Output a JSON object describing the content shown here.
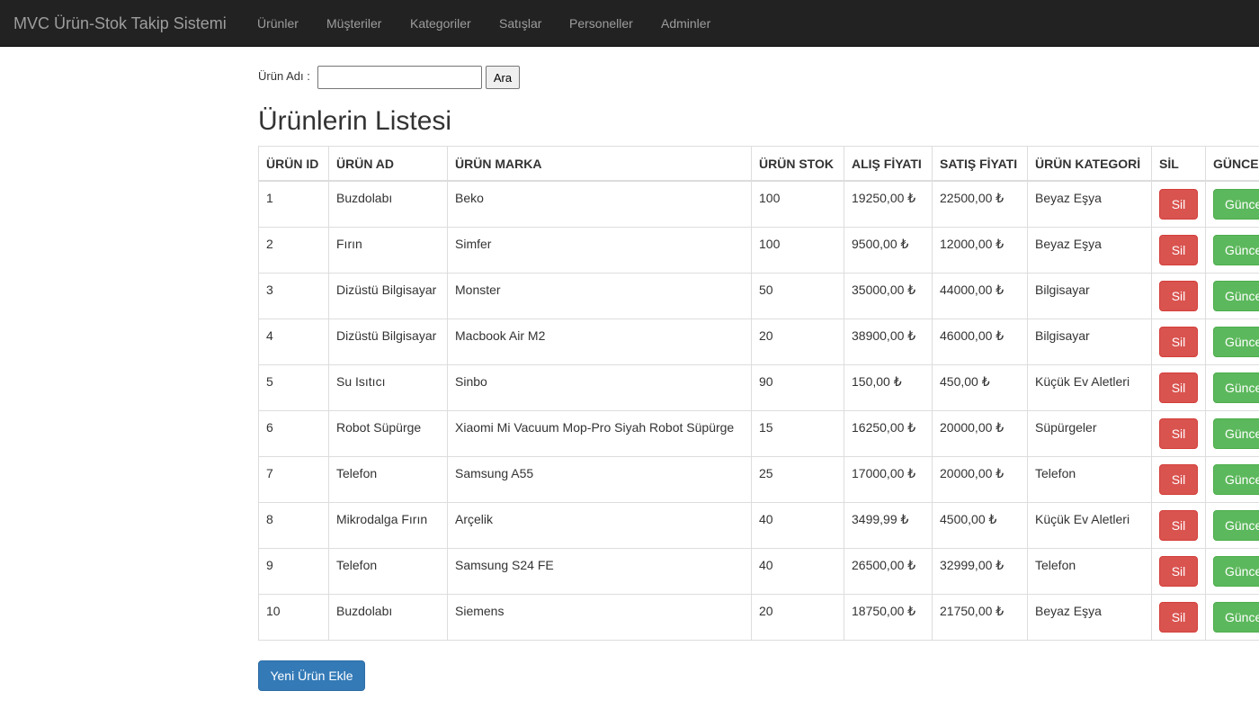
{
  "navbar": {
    "brand": "MVC Ürün-Stok Takip Sistemi",
    "items": [
      {
        "label": "Ürünler"
      },
      {
        "label": "Müşteriler"
      },
      {
        "label": "Kategoriler"
      },
      {
        "label": "Satışlar"
      },
      {
        "label": "Personeller"
      },
      {
        "label": "Adminler"
      }
    ]
  },
  "search": {
    "label": "Ürün Adı :",
    "value": "",
    "button_label": "Ara"
  },
  "page_title": "Ürünlerin Listesi",
  "table": {
    "headers": [
      "ÜRÜN ID",
      "ÜRÜN AD",
      "ÜRÜN MARKA",
      "ÜRÜN STOK",
      "ALIŞ FİYATI",
      "SATIŞ FİYATI",
      "ÜRÜN KATEGORİ",
      "SİL",
      "GÜNCELLE"
    ],
    "delete_label": "Sil",
    "update_label": "Güncelle",
    "rows": [
      {
        "id": "1",
        "name": "Buzdolabı",
        "brand": "Beko",
        "stock": "100",
        "buy": "19250,00 ₺",
        "sell": "22500,00 ₺",
        "category": "Beyaz Eşya"
      },
      {
        "id": "2",
        "name": "Fırın",
        "brand": "Simfer",
        "stock": "100",
        "buy": "9500,00 ₺",
        "sell": "12000,00 ₺",
        "category": "Beyaz Eşya"
      },
      {
        "id": "3",
        "name": "Dizüstü Bilgisayar",
        "brand": "Monster",
        "stock": "50",
        "buy": "35000,00 ₺",
        "sell": "44000,00 ₺",
        "category": "Bilgisayar"
      },
      {
        "id": "4",
        "name": "Dizüstü Bilgisayar",
        "brand": "Macbook Air M2",
        "stock": "20",
        "buy": "38900,00 ₺",
        "sell": "46000,00 ₺",
        "category": "Bilgisayar"
      },
      {
        "id": "5",
        "name": "Su Isıtıcı",
        "brand": "Sinbo",
        "stock": "90",
        "buy": "150,00 ₺",
        "sell": "450,00 ₺",
        "category": "Küçük Ev Aletleri"
      },
      {
        "id": "6",
        "name": "Robot Süpürge",
        "brand": "Xiaomi Mi Vacuum Mop-Pro Siyah Robot Süpürge",
        "stock": "15",
        "buy": "16250,00 ₺",
        "sell": "20000,00 ₺",
        "category": "Süpürgeler"
      },
      {
        "id": "7",
        "name": "Telefon",
        "brand": "Samsung A55",
        "stock": "25",
        "buy": "17000,00 ₺",
        "sell": "20000,00 ₺",
        "category": "Telefon"
      },
      {
        "id": "8",
        "name": "Mikrodalga Fırın",
        "brand": "Arçelik",
        "stock": "40",
        "buy": "3499,99 ₺",
        "sell": "4500,00 ₺",
        "category": "Küçük Ev Aletleri"
      },
      {
        "id": "9",
        "name": "Telefon",
        "brand": "Samsung S24 FE",
        "stock": "40",
        "buy": "26500,00 ₺",
        "sell": "32999,00 ₺",
        "category": "Telefon"
      },
      {
        "id": "10",
        "name": "Buzdolabı",
        "brand": "Siemens",
        "stock": "20",
        "buy": "18750,00 ₺",
        "sell": "21750,00 ₺",
        "category": "Beyaz Eşya"
      }
    ]
  },
  "add_button_label": "Yeni Ürün Ekle",
  "colors": {
    "navbar_bg": "#222222",
    "danger": "#d9534f",
    "success": "#5cb85c",
    "primary": "#337ab7"
  }
}
